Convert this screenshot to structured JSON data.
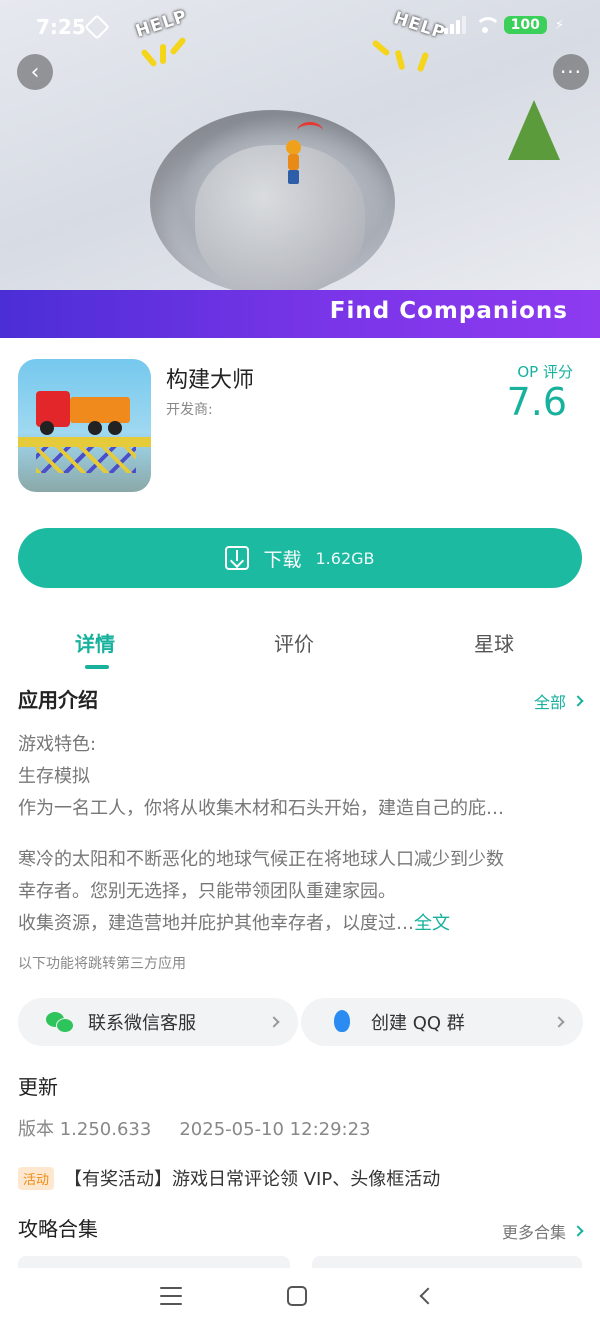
{
  "status_bar": {
    "time": "7:25",
    "battery": "100"
  },
  "hero": {
    "help_text_1": "HELP",
    "help_text_2": "HELP",
    "promo_text": "Find Companions",
    "colors": {
      "promo_band_start": "#4b2ed6",
      "promo_band_end": "#8e3bf0"
    }
  },
  "nav": {
    "back_glyph": "‹",
    "more_glyph": "···"
  },
  "app": {
    "name": "构建大师",
    "developer_label": "开发商:",
    "rating_label": "OP 评分",
    "rating_value": "7.6"
  },
  "download": {
    "label": "下载",
    "size": "1.62GB"
  },
  "tabs": [
    {
      "label": "详情",
      "active": true
    },
    {
      "label": "评价",
      "active": false
    },
    {
      "label": "星球",
      "active": false
    }
  ],
  "intro": {
    "title": "应用介绍",
    "all_link": "全部",
    "lines": [
      "游戏特色:",
      "生存模拟",
      "作为一名工人，你将从收集木材和石头开始，建造自己的庇…",
      "寒冷的太阳和不断恶化的地球气候正在将地球人口减少到少数",
      "幸存者。您别无选择，只能带领团队重建家园。",
      "收集资源，建造营地并庇护其他幸存者，以度过…"
    ],
    "full_text_link": "全文",
    "third_party_note": "以下功能将跳转第三方应用"
  },
  "contacts": [
    {
      "label": "联系微信客服",
      "icon": "wechat-icon"
    },
    {
      "label": "创建 QQ 群",
      "icon": "qq-icon"
    }
  ],
  "update": {
    "title": "更新",
    "version": "版本 1.250.633",
    "date": "2025-05-10 12:29:23"
  },
  "activity": {
    "badge": "活动",
    "text": "【有奖活动】游戏日常评论领 VIP、头像框活动"
  },
  "strategy": {
    "title": "攻略合集",
    "more_link": "更多合集"
  },
  "colors": {
    "accent": "#17b19d",
    "download_button": "#1dbaa2"
  }
}
